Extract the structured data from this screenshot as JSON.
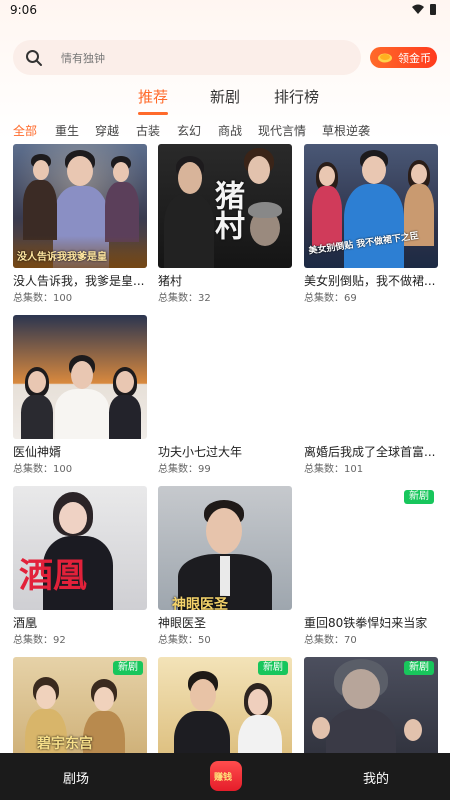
{
  "status_bar": {
    "time": "9:06"
  },
  "search": {
    "placeholder": "情有独钟",
    "coin_button": "领金币"
  },
  "tabs": [
    {
      "label": "推荐",
      "active": true
    },
    {
      "label": "新剧",
      "active": false
    },
    {
      "label": "排行榜",
      "active": false
    }
  ],
  "categories": [
    {
      "label": "全部",
      "active": true
    },
    {
      "label": "重生"
    },
    {
      "label": "穿越"
    },
    {
      "label": "古装"
    },
    {
      "label": "玄幻"
    },
    {
      "label": "商战"
    },
    {
      "label": "现代言情"
    },
    {
      "label": "草根逆袭"
    }
  ],
  "count_prefix": "总集数：",
  "dramas": [
    {
      "title": "没人告诉我，我爹是皇...",
      "episodes": "100",
      "poster_text": "没人告诉我我爹是皇"
    },
    {
      "title": "猪村",
      "episodes": "32",
      "poster_text": "猪村"
    },
    {
      "title": "美女别倒贴，我不做裙...",
      "episodes": "69",
      "poster_text": "美女别倒贴 我不做裙下之臣"
    },
    {
      "title": "医仙神婿",
      "episodes": "100"
    },
    {
      "title": "功夫小七过大年",
      "episodes": "99"
    },
    {
      "title": "离婚后我成了全球首富...",
      "episodes": "101"
    },
    {
      "title": "酒凰",
      "episodes": "92",
      "poster_text": "酒凰"
    },
    {
      "title": "神眼医圣",
      "episodes": "50",
      "poster_text": "神眼医圣"
    },
    {
      "title": "重回80铁拳悍妇来当家",
      "episodes": "70",
      "badge": "新剧"
    },
    {
      "badge": "新剧",
      "poster_text": "碧宇东宫"
    },
    {
      "badge": "新剧"
    },
    {
      "badge": "新剧"
    }
  ],
  "bottom_nav": {
    "left": "剧场",
    "center": "赚钱",
    "right": "我的"
  },
  "colors": {
    "accent": "#ff6a2a",
    "new_badge": "#18c65c",
    "bottom_bar": "#1b1b1b"
  }
}
